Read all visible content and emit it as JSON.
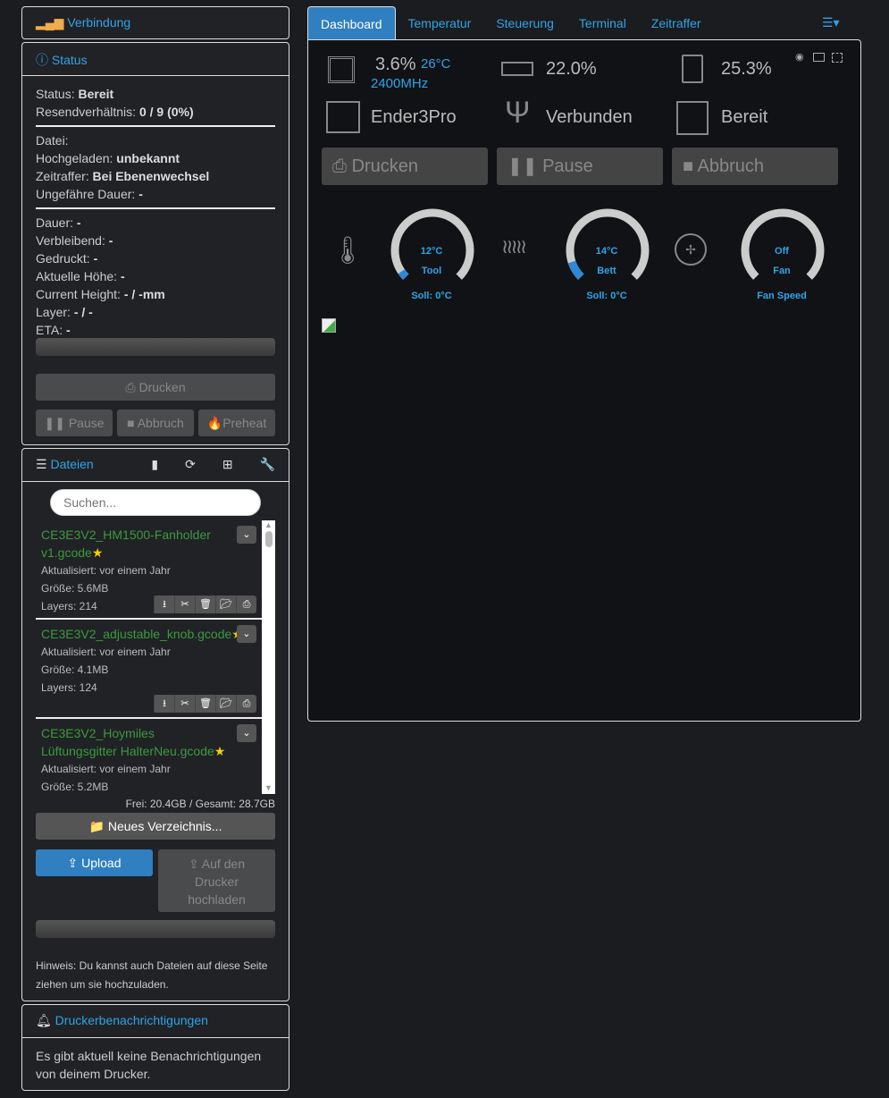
{
  "connection": {
    "title": "Verbindung"
  },
  "status": {
    "title": "Status",
    "rows1": [
      [
        "Status:",
        "Bereit"
      ],
      [
        "Resendverhältnis:",
        "0 / 9 (0%)"
      ]
    ],
    "rows2": [
      [
        "Datei:",
        ""
      ],
      [
        "Hochgeladen:",
        "unbekannt"
      ],
      [
        "Zeitraffer:",
        "Bei Ebenenwechsel"
      ],
      [
        "Ungefähre Dauer:",
        "-"
      ]
    ],
    "rows3": [
      [
        "Dauer:",
        "-"
      ],
      [
        "Verbleibend:",
        "-"
      ],
      [
        "Gedruckt:",
        "-"
      ],
      [
        "Aktuelle Höhe:",
        "-"
      ],
      [
        "Current Height:",
        "- / -mm"
      ],
      [
        "Layer:",
        "- / -"
      ],
      [
        "ETA:",
        "-"
      ]
    ],
    "print": "Drucken",
    "pause": "Pause",
    "cancel": "Abbruch",
    "preheat": "Preheat"
  },
  "files": {
    "title": "Dateien",
    "search_placeholder": "Suchen...",
    "items": [
      {
        "name": "CE3E3V2_HM1500-Fanholder v1.gcode",
        "updated": "Aktualisiert: vor einem Jahr",
        "size": "Größe: 5.6MB",
        "layers": "Layers: 214"
      },
      {
        "name": "CE3E3V2_adjustable_knob.gcode",
        "updated": "Aktualisiert: vor einem Jahr",
        "size": "Größe: 4.1MB",
        "layers": "Layers: 124"
      },
      {
        "name": "CE3E3V2_Hoymiles Lüftungsgitter HalterNeu.gcode",
        "updated": "Aktualisiert: vor einem Jahr",
        "size": "Größe: 5.2MB",
        "layers": ""
      }
    ],
    "storage": "Frei: 20.4GB / Gesamt: 28.7GB",
    "new_folder": "Neues Verzeichnis...",
    "upload": "Upload",
    "upload_printer": "Auf den Drucker hochladen",
    "hint": "Hinweis: Du kannst auch Dateien auf diese Seite ziehen um sie hochzuladen."
  },
  "notifications": {
    "title": "Druckerbenachrichtigungen",
    "text": "Es gibt aktuell keine Benachrichtigungen von deinem Drucker."
  },
  "tabs": [
    "Dashboard",
    "Temperatur",
    "Steuerung",
    "Terminal",
    "Zeitraffer"
  ],
  "dashboard": {
    "cpu": "3.6%",
    "cpu_temp": "26°C",
    "cpu_freq": "2400MHz",
    "mem": "22.0%",
    "disk": "25.3%",
    "printer": "Ender3Pro",
    "connection": "Verbunden",
    "state": "Bereit",
    "print": "Drucken",
    "pause": "Pause",
    "cancel": "Abbruch",
    "gauges": [
      {
        "value": "12°C",
        "label": "Tool",
        "sub": "Soll: 0°C",
        "fill": 0.04
      },
      {
        "value": "14°C",
        "label": "Bett",
        "sub": "Soll: 0°C",
        "fill": 0.1
      },
      {
        "value": "Off",
        "label": "Fan",
        "sub": "Fan Speed",
        "fill": 0
      }
    ]
  }
}
